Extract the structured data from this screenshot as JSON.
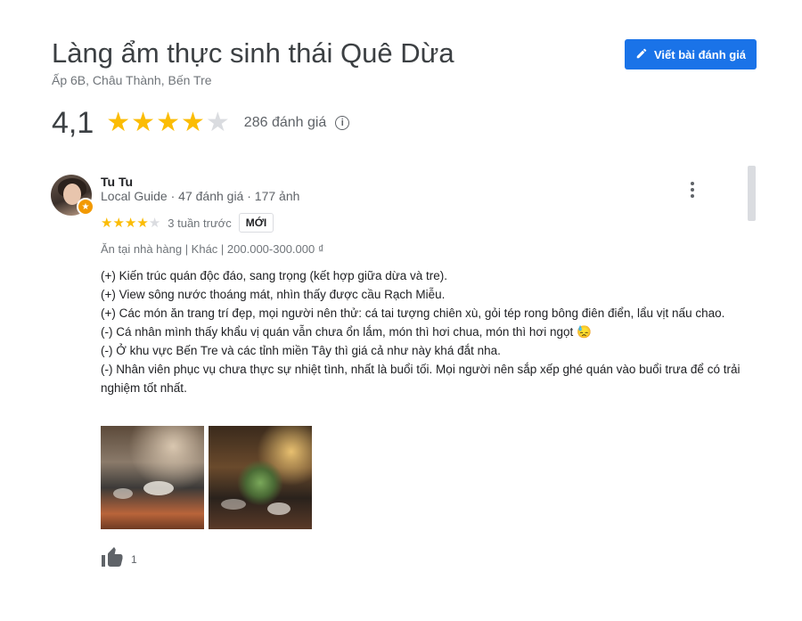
{
  "place": {
    "name": "Làng ẩm thực sinh thái Quê Dừa",
    "address": "Ấp 6B, Châu Thành, Bến Tre",
    "rating": "4,1",
    "stars": 4,
    "review_count": "286 đánh giá"
  },
  "write_review_label": "Viết bài đánh giá",
  "review": {
    "author": "Tu Tu",
    "author_meta": "Local Guide · 47 đánh giá · 177 ảnh",
    "stars": 4,
    "time_ago": "3 tuần trước",
    "badge": "MỚI",
    "attributes": "Ăn tại nhà hàng  |  Khác  |  200.000-300.000 ₫",
    "lines": [
      "(+) Kiến trúc quán độc đáo, sang trọng (kết hợp giữa dừa và tre).",
      "(+) View sông nước thoáng mát, nhìn thấy được cầu Rạch Miễu.",
      "(+) Các món ăn trang trí đẹp, mọi người nên thử: cá tai tượng chiên xù, gỏi tép rong bông điên điển, lẩu vịt nấu chao.",
      "(-) Cá nhân mình thấy khẩu vị quán vẫn chưa ổn lắm, món thì hơi chua, món thì hơi ngọt 😓",
      "(-) Ở khu vực Bến Tre và các tỉnh miền Tây thì giá cả như này khá đắt nha.",
      "(-) Nhân viên phục vụ chưa thực sự nhiệt tình, nhất là buổi tối. Mọi người nên sắp xếp ghé quán vào buổi trưa để có trải nghiệm tốt nhất."
    ],
    "likes": "1"
  },
  "icons": {
    "pencil": "pencil-icon",
    "info": "info-icon",
    "more": "more-vert-icon",
    "thumb": "thumb-up-icon",
    "guide": "local-guide-star-icon"
  },
  "colors": {
    "accent": "#1a73e8",
    "star": "#fbbc04",
    "star_empty": "#dadce0"
  }
}
